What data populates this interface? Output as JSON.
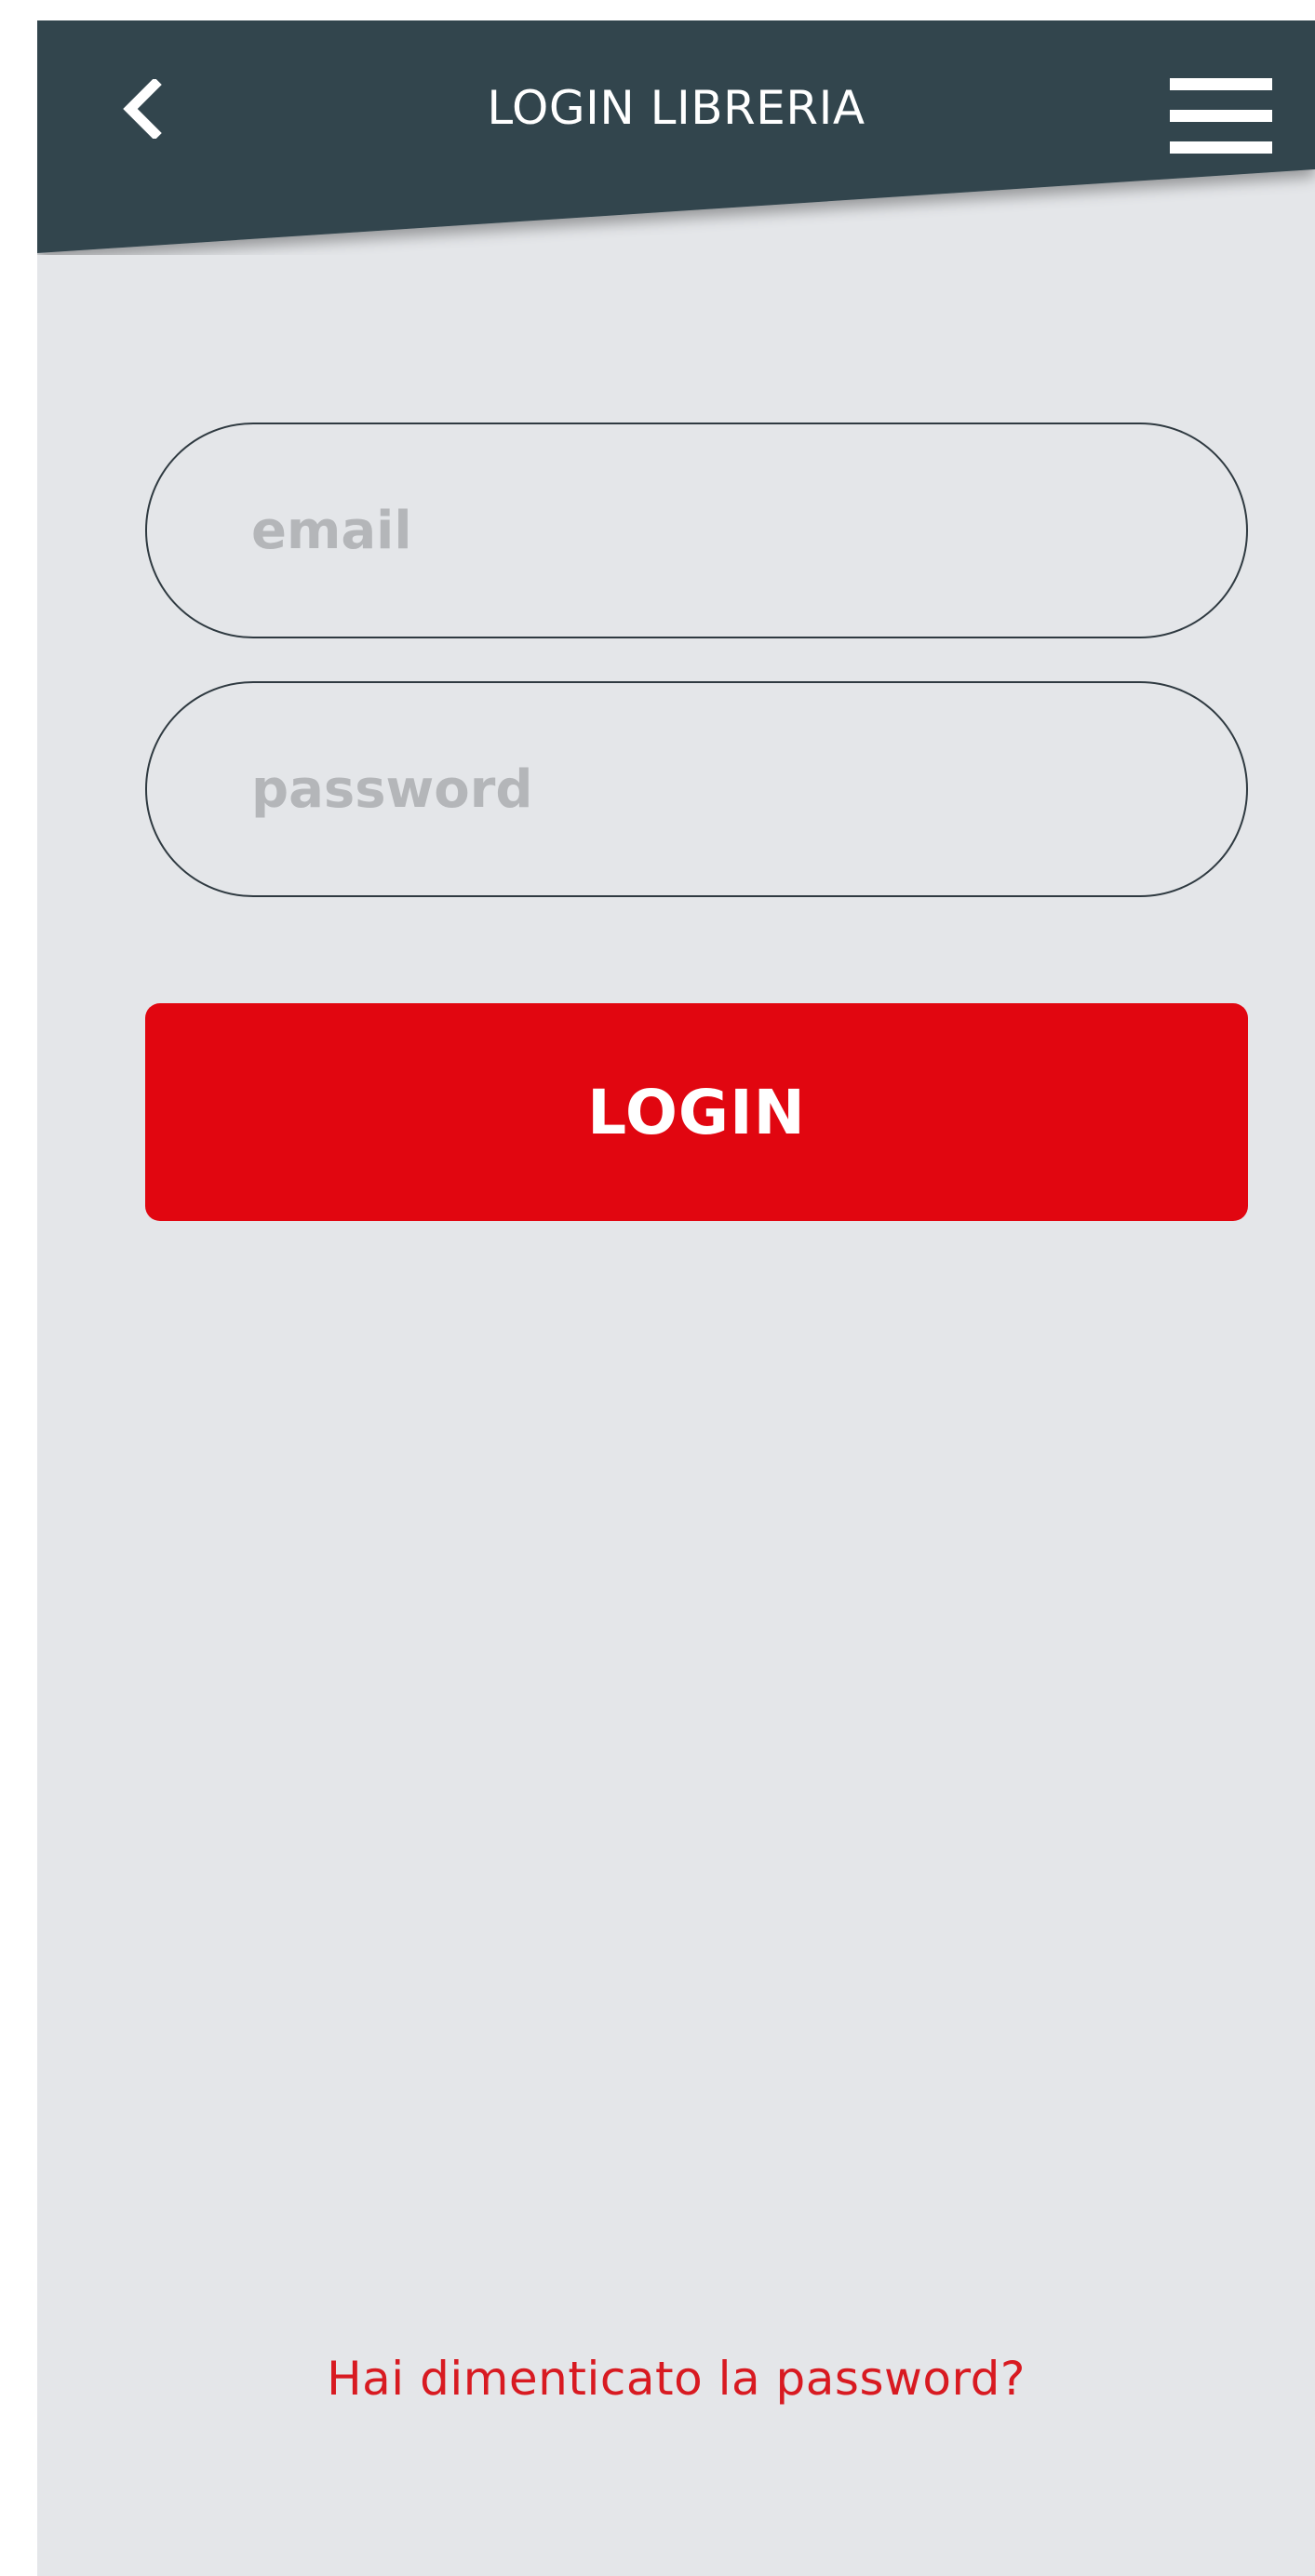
{
  "header": {
    "title": "LOGIN LIBRERIA",
    "back_icon": "chevron-left-icon",
    "menu_icon": "hamburger-menu-icon",
    "background_color": "#33454e"
  },
  "form": {
    "email": {
      "value": "",
      "placeholder": "email"
    },
    "password": {
      "value": "",
      "placeholder": "password"
    },
    "login_label": "LOGIN",
    "login_color": "#e10610"
  },
  "footer": {
    "forgot_password": "Hai dimenticato la password?",
    "link_color": "#d81a21"
  },
  "background_color": "#e4e6e9"
}
